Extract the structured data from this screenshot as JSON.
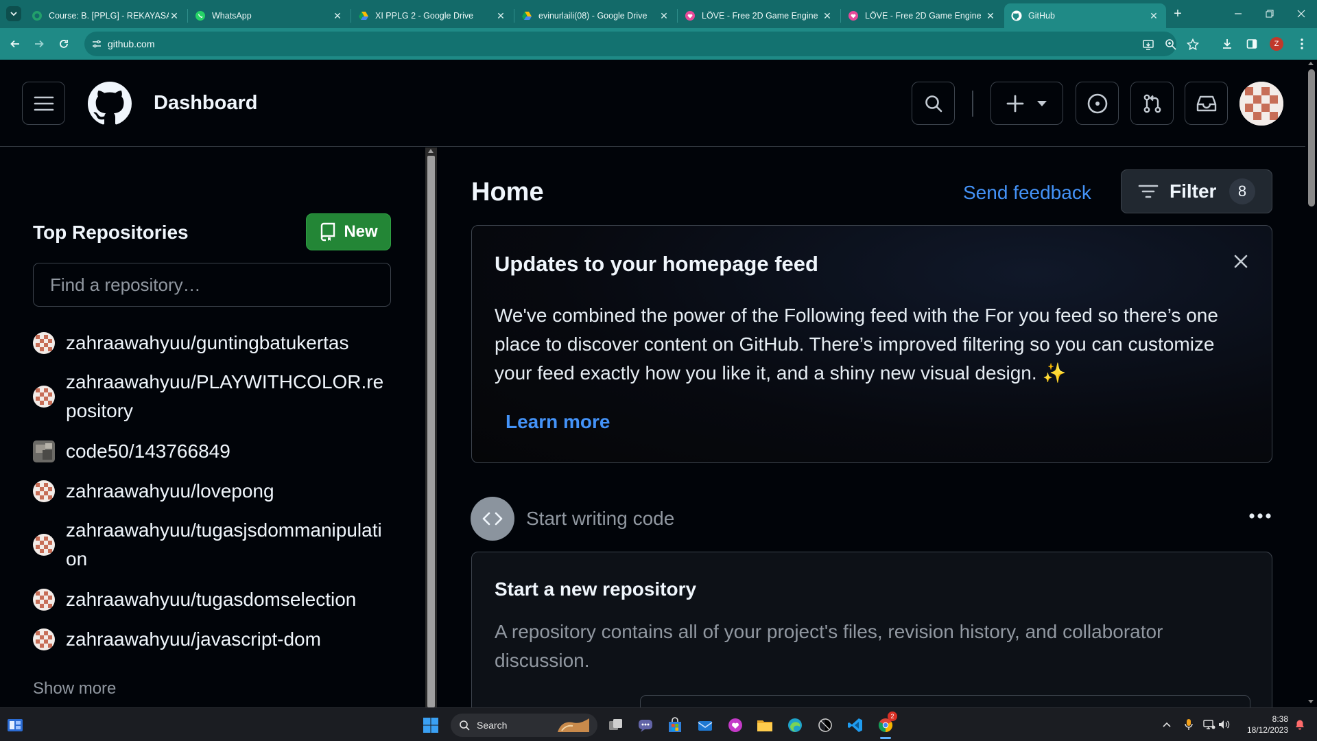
{
  "browser": {
    "tabs": [
      {
        "title": "Course: B. [PPLG] - REKAYASA P",
        "icon": "moodle-icon"
      },
      {
        "title": "WhatsApp",
        "icon": "whatsapp-icon"
      },
      {
        "title": "XI PPLG 2 - Google Drive",
        "icon": "google-drive-icon"
      },
      {
        "title": "evinurlaili(08) - Google Drive",
        "icon": "google-drive-icon"
      },
      {
        "title": "LÖVE - Free 2D Game Engine",
        "icon": "love-icon"
      },
      {
        "title": "LÖVE - Free 2D Game Engine",
        "icon": "love-icon"
      },
      {
        "title": "GitHub",
        "icon": "github-icon",
        "active": true
      }
    ],
    "url": "github.com",
    "profile_initial": "Z",
    "theme_color": "#1f8a86"
  },
  "header": {
    "title": "Dashboard"
  },
  "sidebar": {
    "heading": "Top Repositories",
    "new_label": "New",
    "search_placeholder": "Find a repository…",
    "repos": [
      {
        "name": "zahraawahyuu/guntingbatukertas"
      },
      {
        "name": "zahraawahyuu/PLAYWITHCOLOR.repository"
      },
      {
        "name": "code50/143766849"
      },
      {
        "name": "zahraawahyuu/lovepong"
      },
      {
        "name": "zahraawahyuu/tugasjsdommanipulation"
      },
      {
        "name": "zahraawahyuu/tugasdomselection"
      },
      {
        "name": "zahraawahyuu/javascript-dom"
      }
    ],
    "show_more": "Show more"
  },
  "main": {
    "title": "Home",
    "send_feedback": "Send feedback",
    "filter_label": "Filter",
    "filter_count": "8",
    "updates": {
      "title": "Updates to your homepage feed",
      "body": "We've combined the power of the Following feed with the For you feed so there’s one place to discover content on GitHub. There’s improved filtering so you can customize your feed exactly how you like it, and a shiny new visual design. ✨",
      "learn_more": "Learn more"
    },
    "start_writing": "Start writing code",
    "new_repo": {
      "title": "Start a new repository",
      "description": "A repository contains all of your project's files, revision history, and collaborator discussion."
    }
  },
  "taskbar": {
    "search_label": "Search",
    "time": "8:38",
    "date": "18/12/2023",
    "chrome_badge": "2"
  },
  "colors": {
    "accent_link": "#4493f8",
    "new_button": "#238636",
    "background": "#010409"
  }
}
